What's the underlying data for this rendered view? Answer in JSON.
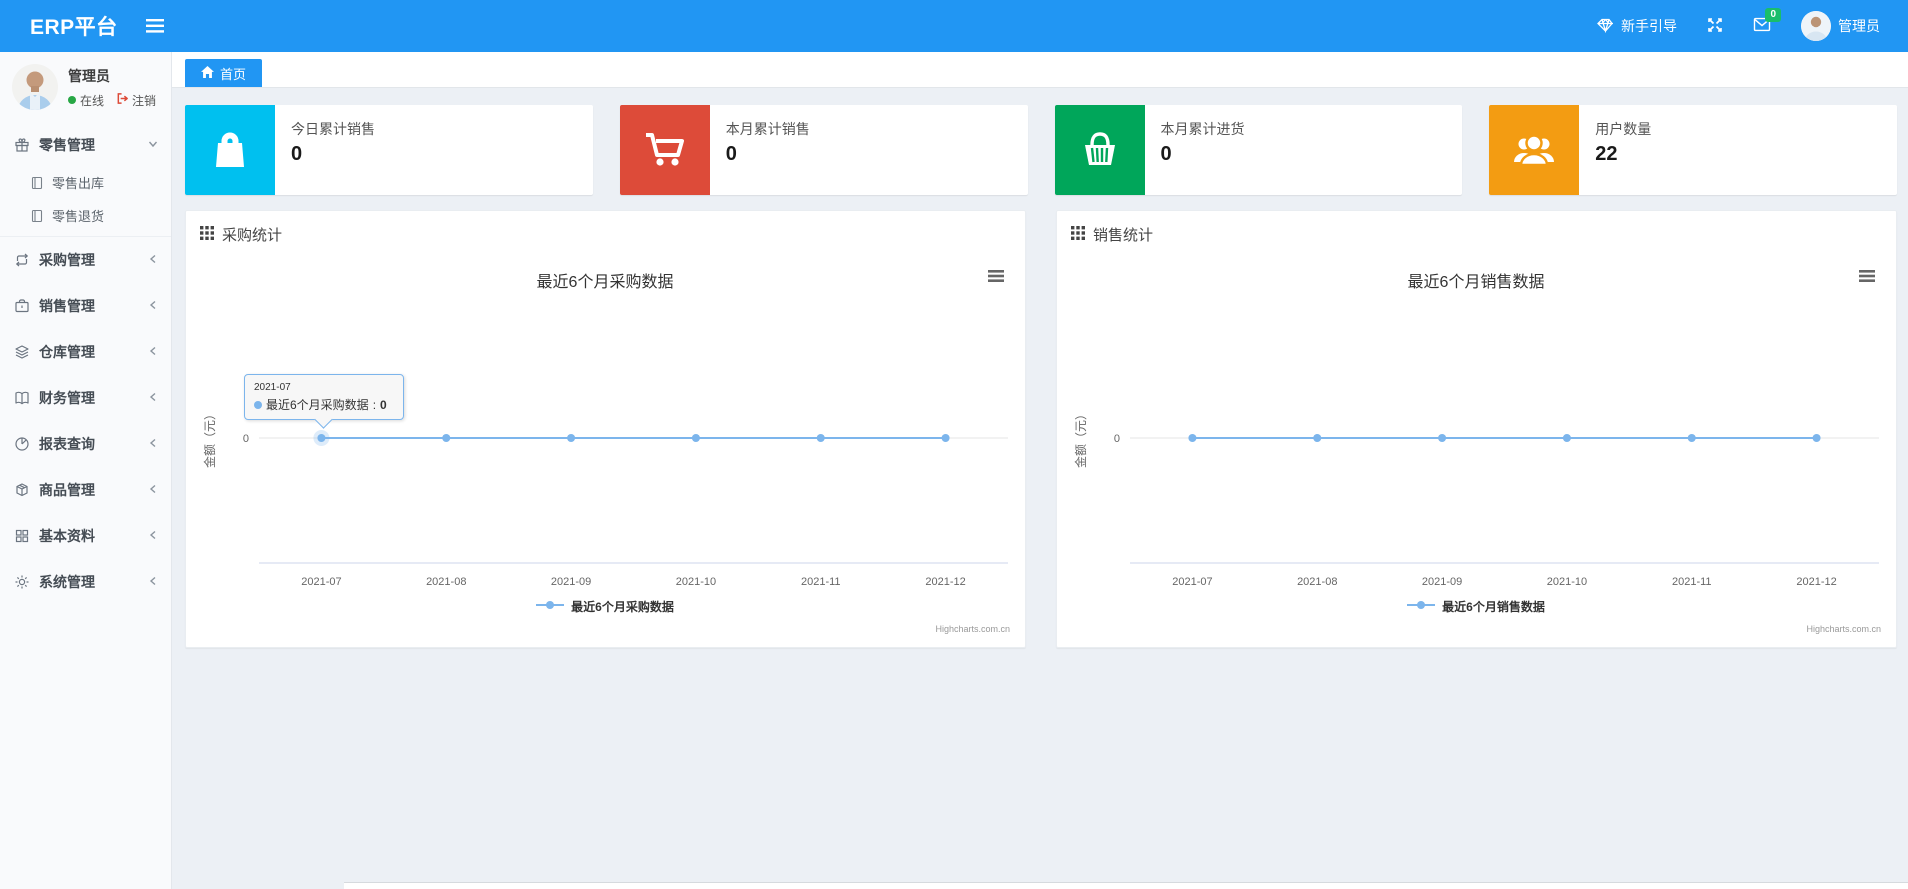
{
  "header": {
    "brand": "ERP平台",
    "guide_label": "新手引导",
    "badge_count": "0",
    "user_label": "管理员"
  },
  "sidebar": {
    "user": {
      "name": "管理员",
      "status": "在线",
      "logout_label": "注销"
    },
    "menu": [
      {
        "label": "零售管理",
        "icon": "gift-icon",
        "expanded": true,
        "children": [
          {
            "label": "零售出库",
            "icon": "file-icon"
          },
          {
            "label": "零售退货",
            "icon": "file-icon"
          }
        ]
      },
      {
        "label": "采购管理",
        "icon": "repeat-icon"
      },
      {
        "label": "销售管理",
        "icon": "briefcase-icon"
      },
      {
        "label": "仓库管理",
        "icon": "layers-icon"
      },
      {
        "label": "财务管理",
        "icon": "book-icon"
      },
      {
        "label": "报表查询",
        "icon": "pie-chart-icon"
      },
      {
        "label": "商品管理",
        "icon": "box-icon"
      },
      {
        "label": "基本资料",
        "icon": "grid-icon"
      },
      {
        "label": "系统管理",
        "icon": "gear-icon"
      }
    ]
  },
  "breadcrumb": {
    "home_label": "首页"
  },
  "cards": [
    {
      "label": "今日累计销售",
      "value": "0",
      "color": "#00c0ef",
      "icon": "shopping-bag-icon"
    },
    {
      "label": "本月累计销售",
      "value": "0",
      "color": "#dd4b39",
      "icon": "shopping-cart-icon"
    },
    {
      "label": "本月累计进货",
      "value": "0",
      "color": "#00a65a",
      "icon": "shopping-basket-icon"
    },
    {
      "label": "用户数量",
      "value": "22",
      "color": "#f39c12",
      "icon": "users-icon"
    }
  ],
  "panels": [
    {
      "header": "采购统计"
    },
    {
      "header": "销售统计"
    }
  ],
  "chart_data": [
    {
      "type": "line",
      "title": "最近6个月采购数据",
      "categories": [
        "2021-07",
        "2021-08",
        "2021-09",
        "2021-10",
        "2021-11",
        "2021-12"
      ],
      "series": [
        {
          "name": "最近6个月采购数据",
          "values": [
            0,
            0,
            0,
            0,
            0,
            0
          ],
          "color": "#7cb5ec"
        }
      ],
      "xlabel": "",
      "ylabel": "金额（元）",
      "yticks": [
        "0"
      ],
      "ylim": [
        -1,
        1
      ],
      "grid": false,
      "legend": "最近6个月采购数据",
      "legend_position": "bottom",
      "credits": "Highcharts.com.cn",
      "hover_point": 0
    },
    {
      "type": "line",
      "title": "最近6个月销售数据",
      "categories": [
        "2021-07",
        "2021-08",
        "2021-09",
        "2021-10",
        "2021-11",
        "2021-12"
      ],
      "series": [
        {
          "name": "最近6个月销售数据",
          "values": [
            0,
            0,
            0,
            0,
            0,
            0
          ],
          "color": "#7cb5ec"
        }
      ],
      "xlabel": "",
      "ylabel": "金额（元）",
      "yticks": [
        "0"
      ],
      "ylim": [
        -1,
        1
      ],
      "grid": false,
      "legend": "最近6个月销售数据",
      "legend_position": "bottom",
      "credits": "Highcharts.com.cn",
      "hover_point": null
    }
  ],
  "tooltip": {
    "date": "2021-07",
    "series": "最近6个月采购数据",
    "separator": ":",
    "value": "0"
  }
}
